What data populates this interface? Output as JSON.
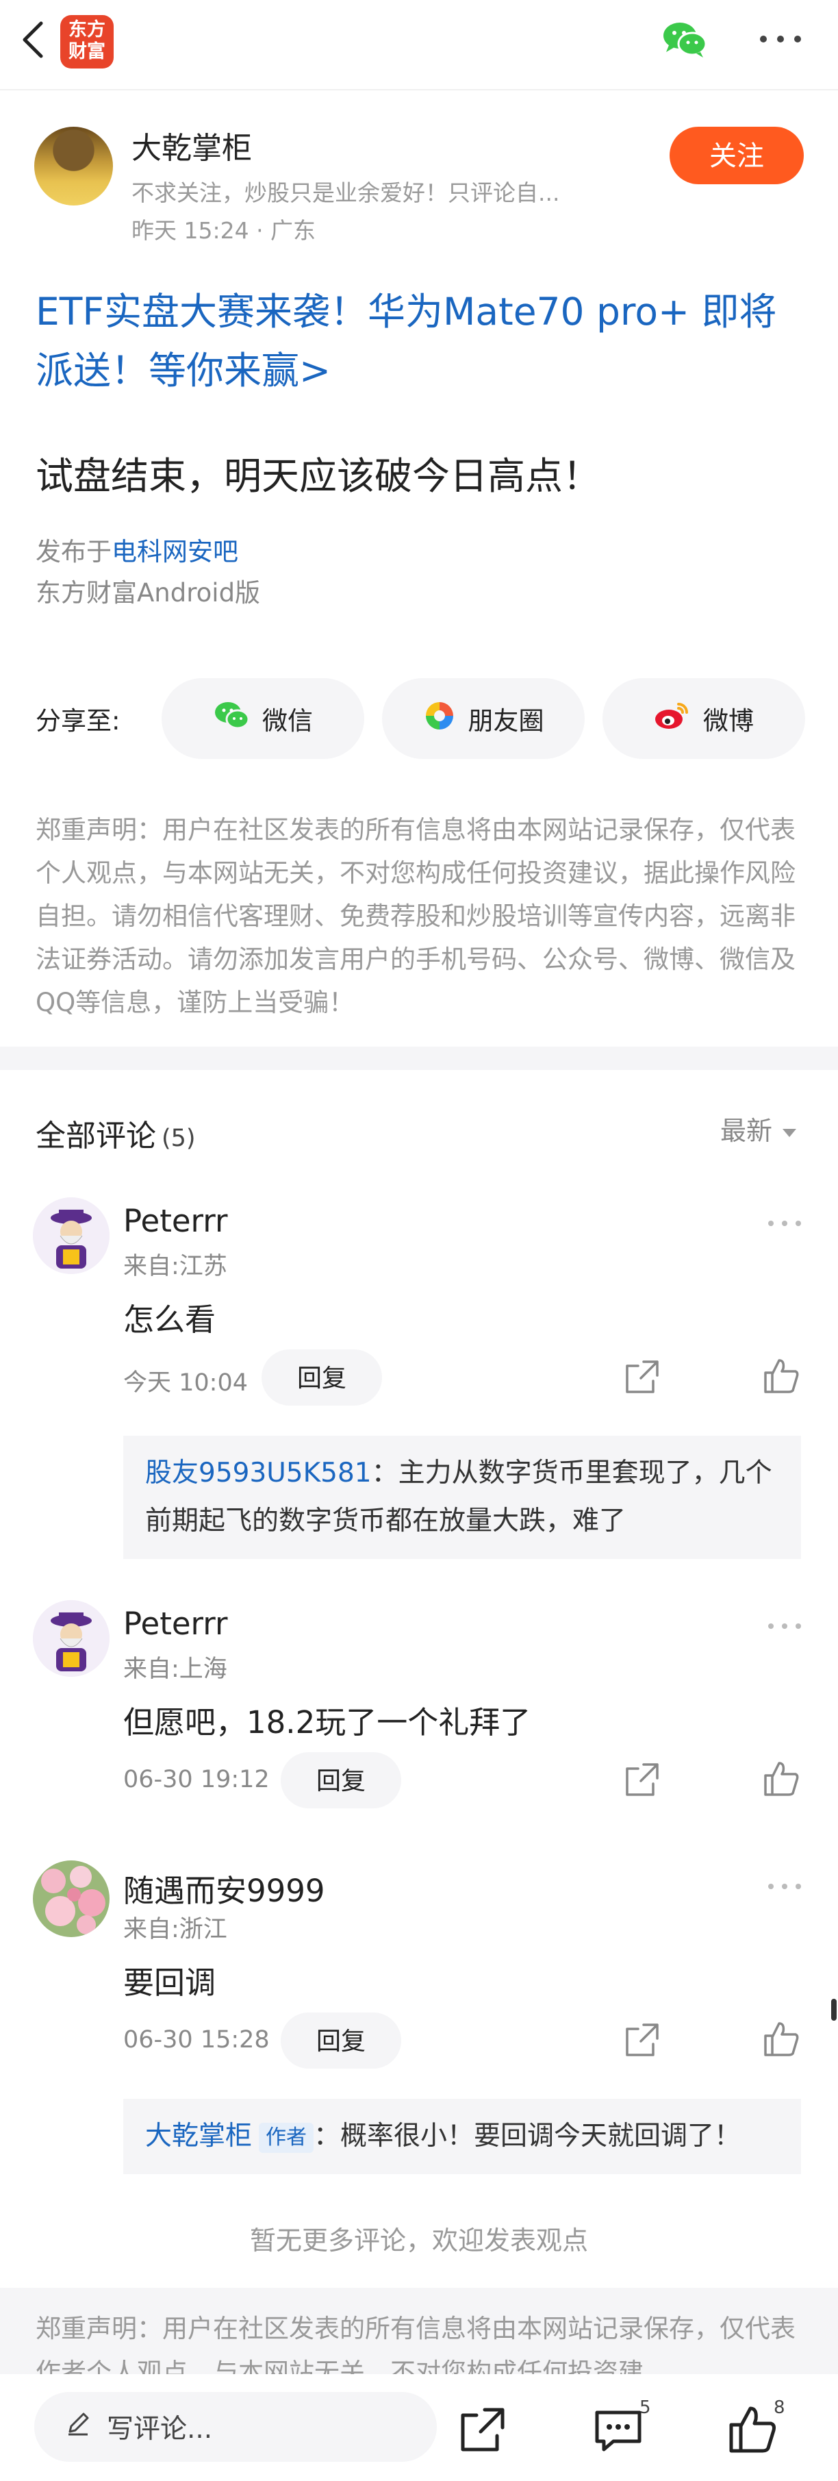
{
  "topbar": {
    "logo_line1": "东方",
    "logo_line2": "财富"
  },
  "author": {
    "name": "大乾掌柜",
    "bio": "不求关注，炒股只是业余爱好！只评论自...",
    "time_location": "昨天 15:24 · 广东",
    "follow_label": "关注"
  },
  "promo_text": "ETF实盘大赛来袭！华为Mate70 pro+ 即将派送！等你来赢>",
  "post": {
    "title": "试盘结束，明天应该破今日高点！",
    "published_prefix": "发布于",
    "bar_name": "电科网安吧",
    "platform": "东方财富Android版"
  },
  "share": {
    "label": "分享至:",
    "wechat": "微信",
    "moments": "朋友圈",
    "weibo": "微博"
  },
  "disclaimer": "郑重声明：用户在社区发表的所有信息将由本网站记录保存，仅代表个人观点，与本网站无关，不对您构成任何投资建议，据此操作风险自担。请勿相信代客理财、免费荐股和炒股培训等宣传内容，远离非法证券活动。请勿添加发言用户的手机号码、公众号、微博、微信及QQ等信息，谨防上当受骗！",
  "comments_header": {
    "title": "全部评论",
    "count": "(5)",
    "sort": "最新"
  },
  "comments": [
    {
      "name": "Peterrr",
      "location": "来自:江苏",
      "text": "怎么看",
      "time": "今天 10:04",
      "reply_label": "回复",
      "sub_reply": {
        "user": "股友9593U5K581",
        "text": "：主力从数字货币里套现了，几个前期起飞的数字货币都在放量大跌，难了"
      }
    },
    {
      "name": "Peterrr",
      "location": "来自:上海",
      "text": "但愿吧，18.2玩了一个礼拜了",
      "time": "06-30 19:12",
      "reply_label": "回复"
    },
    {
      "name": "随遇而安9999",
      "location": "来自:浙江",
      "text": "要回调",
      "time": "06-30 15:28",
      "reply_label": "回复",
      "sub_reply": {
        "user": "大乾掌柜",
        "tag": "作者",
        "text": "：概率很小！要回调今天就回调了！"
      }
    }
  ],
  "no_more": "暂无更多评论，欢迎发表观点",
  "bottom_disclaimer": "郑重声明：用户在社区发表的所有信息将由本网站记录保存，仅代表作者个人观点，与本网站无关，不对您构成任何投资建",
  "bottombar": {
    "input_placeholder": "写评论...",
    "comment_count": "5",
    "like_count": "8"
  },
  "colors": {
    "accent": "#ff5a1f",
    "link": "#1a66c0",
    "brand": "#e8442a"
  },
  "icons": [
    "back-icon",
    "wechat-icon",
    "more-icon",
    "moments-icon",
    "weibo-icon",
    "share-icon",
    "like-icon",
    "comment-icon",
    "pen-icon"
  ]
}
